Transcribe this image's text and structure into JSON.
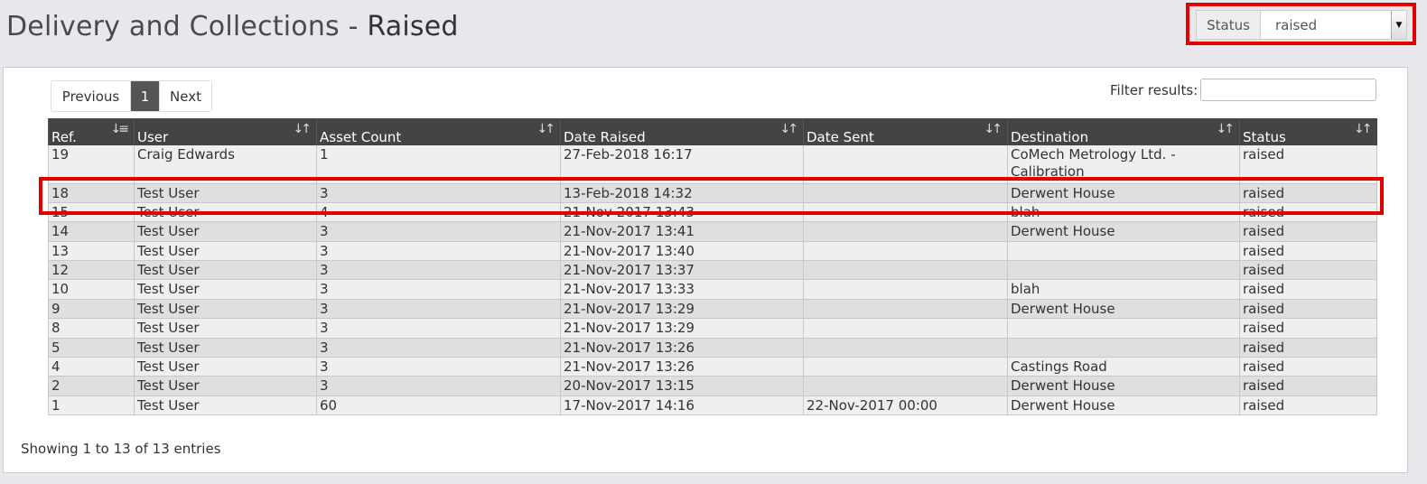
{
  "page": {
    "title_prefix": "Delivery and Collections - ",
    "title_strong": "Raised"
  },
  "status_filter": {
    "label": "Status",
    "selected": "raised"
  },
  "pagination": {
    "previous": "Previous",
    "current": "1",
    "next": "Next"
  },
  "filter": {
    "label": "Filter results:",
    "value": ""
  },
  "table": {
    "columns": [
      "Ref.",
      "User",
      "Asset Count",
      "Date Raised",
      "Date Sent",
      "Destination",
      "Status"
    ],
    "rows": [
      [
        "19",
        "Craig Edwards",
        "1",
        "27-Feb-2018 16:17",
        "",
        "CoMech Metrology Ltd. - Calibration",
        "raised"
      ],
      [
        "18",
        "Test User",
        "3",
        "13-Feb-2018 14:32",
        "",
        "Derwent House",
        "raised"
      ],
      [
        "15",
        "Test User",
        "4",
        "21-Nov-2017 13:43",
        "",
        "blah",
        "raised"
      ],
      [
        "14",
        "Test User",
        "3",
        "21-Nov-2017 13:41",
        "",
        "Derwent House",
        "raised"
      ],
      [
        "13",
        "Test User",
        "3",
        "21-Nov-2017 13:40",
        "",
        "",
        "raised"
      ],
      [
        "12",
        "Test User",
        "3",
        "21-Nov-2017 13:37",
        "",
        "",
        "raised"
      ],
      [
        "10",
        "Test User",
        "3",
        "21-Nov-2017 13:33",
        "",
        "blah",
        "raised"
      ],
      [
        "9",
        "Test User",
        "3",
        "21-Nov-2017 13:29",
        "",
        "Derwent House",
        "raised"
      ],
      [
        "8",
        "Test User",
        "3",
        "21-Nov-2017 13:29",
        "",
        "",
        "raised"
      ],
      [
        "5",
        "Test User",
        "3",
        "21-Nov-2017 13:26",
        "",
        "",
        "raised"
      ],
      [
        "4",
        "Test User",
        "3",
        "21-Nov-2017 13:26",
        "",
        "Castings Road",
        "raised"
      ],
      [
        "2",
        "Test User",
        "3",
        "20-Nov-2017 13:15",
        "",
        "Derwent House",
        "raised"
      ],
      [
        "1",
        "Test User",
        "60",
        "17-Nov-2017 14:16",
        "22-Nov-2017 00:00",
        "Derwent House",
        "raised"
      ]
    ]
  },
  "info": "Showing 1 to 13 of 13 entries"
}
